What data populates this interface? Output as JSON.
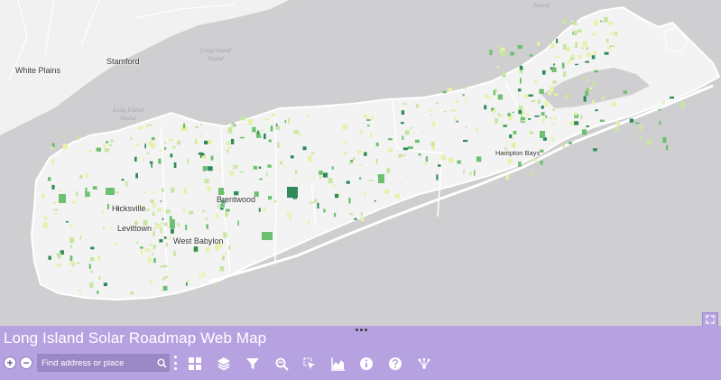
{
  "app": {
    "title": "Long Island Solar Roadmap Web Map"
  },
  "map": {
    "places": [
      {
        "name": "White Plains"
      },
      {
        "name": "Stamford"
      },
      {
        "name": "Hicksville"
      },
      {
        "name": "Levittown"
      },
      {
        "name": "Brentwood"
      },
      {
        "name": "West Babylon"
      },
      {
        "name": "Hampton Bays"
      }
    ],
    "water_labels": [
      {
        "name": "Long Island Sound"
      },
      {
        "name": "Long Island Sound"
      },
      {
        "name": "Sound"
      }
    ]
  },
  "controls": {
    "zoom_in_label": "+",
    "zoom_out_label": "−",
    "search_placeholder": "Find address or place"
  },
  "toolbar": {
    "tools": [
      {
        "name": "basemap-gallery",
        "icon": "grid-icon"
      },
      {
        "name": "layers",
        "icon": "layers-icon"
      },
      {
        "name": "filter",
        "icon": "filter-icon"
      },
      {
        "name": "query",
        "icon": "query-icon"
      },
      {
        "name": "select",
        "icon": "select-icon"
      },
      {
        "name": "chart",
        "icon": "chart-icon"
      },
      {
        "name": "about",
        "icon": "info-icon"
      },
      {
        "name": "help",
        "icon": "help-icon"
      },
      {
        "name": "share",
        "icon": "share-icon"
      }
    ]
  },
  "colors": {
    "panel": "#b6a2e1",
    "water": "#cfcfd1",
    "land": "#f3f3f3",
    "parcel_dark": "#2e8b57",
    "parcel_mid": "#6cc070",
    "parcel_light": "#c8e6a0",
    "parcel_pale": "#e6f2a8"
  }
}
